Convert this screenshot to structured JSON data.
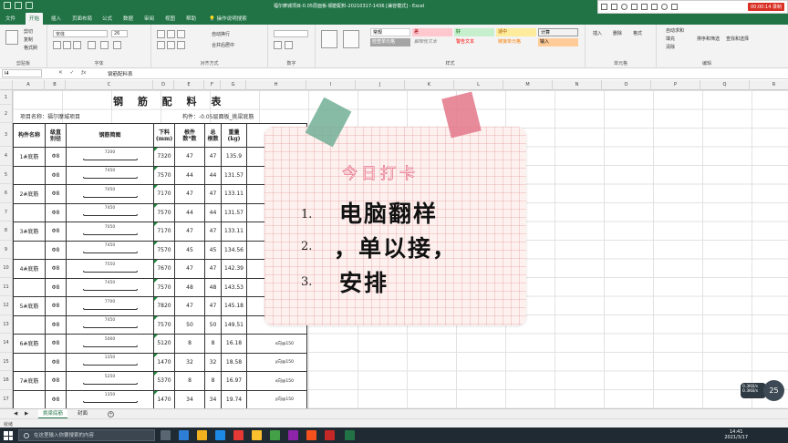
{
  "titlebar": {
    "title": "福尔摩城项目-0.05层面板-钢筋配料-20210317-1436 [兼容模式] - Excel"
  },
  "menu": {
    "tabs": [
      "文件",
      "开始",
      "插入",
      "页面布局",
      "公式",
      "数据",
      "审阅",
      "视图",
      "帮助"
    ],
    "active": "开始",
    "tell_me": "操作说明搜索"
  },
  "recorder": {
    "time": "00:00:14 录制"
  },
  "ribbon": {
    "clipboard": {
      "label": "剪贴板",
      "cut": "剪切",
      "copy": "复制",
      "painter": "格式刷"
    },
    "font": {
      "label": "字体",
      "name": "宋体",
      "size": "26"
    },
    "align": {
      "label": "对齐方式",
      "wrap": "自动换行",
      "merge": "合并后居中"
    },
    "number": {
      "label": "数字"
    },
    "styles": {
      "label": "样式",
      "items": [
        "常规",
        "差",
        "好",
        "适中",
        "检查单元格",
        "解释性文本",
        "警告文本",
        "链接单元格",
        "计算",
        "输入",
        "输出",
        "注释"
      ]
    },
    "cells": {
      "label": "单元格",
      "insert": "插入",
      "delete": "删除",
      "format": "格式"
    },
    "editing": {
      "label": "编辑",
      "autosum": "自动求和",
      "fill": "填充",
      "clear": "清除",
      "sort": "排序和筛选",
      "find": "查找和选择"
    }
  },
  "formula_bar": {
    "name_box": "I4",
    "formula": "钢筋配料表"
  },
  "columns": [
    "A",
    "B",
    "C",
    "D",
    "E",
    "F",
    "G",
    "H",
    "I",
    "J",
    "K",
    "L",
    "M",
    "N",
    "O",
    "P",
    "Q",
    "R",
    "S",
    "T"
  ],
  "rows": [
    "1",
    "2",
    "3",
    "4",
    "5",
    "6",
    "7",
    "8",
    "9",
    "10",
    "11",
    "12",
    "13",
    "14",
    "15",
    "16",
    "17"
  ],
  "sheet": {
    "title": "钢 筋 配 料 表",
    "project": "项目名称：福尔摩城项目",
    "member": "构件：-0.05层面板_挑梁底筋",
    "headers": [
      "构件名称",
      "级直\n别径",
      "钢筋简图",
      "下料\n(mm)",
      "根件\n数*数",
      "总\n根数",
      "重量\n(kg)",
      ""
    ],
    "data": [
      {
        "name": "1#底筋",
        "grade": "Φ8",
        "shape": "7200",
        "cut": "7320",
        "per": "47",
        "total": "47",
        "weight": "135.9",
        "note": ""
      },
      {
        "name": "",
        "grade": "Φ8",
        "shape": "7450",
        "cut": "7570",
        "per": "44",
        "total": "44",
        "weight": "131.57",
        "note": ""
      },
      {
        "name": "2#底筋",
        "grade": "Φ8",
        "shape": "7050",
        "cut": "7170",
        "per": "47",
        "total": "47",
        "weight": "133.11",
        "note": ""
      },
      {
        "name": "",
        "grade": "Φ8",
        "shape": "7450",
        "cut": "7570",
        "per": "44",
        "total": "44",
        "weight": "131.57",
        "note": ""
      },
      {
        "name": "3#底筋",
        "grade": "Φ8",
        "shape": "7050",
        "cut": "7170",
        "per": "47",
        "total": "47",
        "weight": "133.11",
        "note": ""
      },
      {
        "name": "",
        "grade": "Φ8",
        "shape": "7450",
        "cut": "7570",
        "per": "45",
        "total": "45",
        "weight": "134.56",
        "note": ""
      },
      {
        "name": "4#底筋",
        "grade": "Φ8",
        "shape": "7550",
        "cut": "7670",
        "per": "47",
        "total": "47",
        "weight": "142.39",
        "note": ""
      },
      {
        "name": "",
        "grade": "Φ8",
        "shape": "7450",
        "cut": "7570",
        "per": "48",
        "total": "48",
        "weight": "143.53",
        "note": ""
      },
      {
        "name": "5#底筋",
        "grade": "Φ8",
        "shape": "7700",
        "cut": "7820",
        "per": "47",
        "total": "47",
        "weight": "145.18",
        "note": ""
      },
      {
        "name": "",
        "grade": "Φ8",
        "shape": "7450",
        "cut": "7570",
        "per": "50",
        "total": "50",
        "weight": "149.51",
        "note": ""
      },
      {
        "name": "6#底筋",
        "grade": "Φ8",
        "shape": "5000",
        "cut": "5120",
        "per": "8",
        "total": "8",
        "weight": "16.18",
        "note": "x向@150"
      },
      {
        "name": "",
        "grade": "Φ8",
        "shape": "1350",
        "cut": "1470",
        "per": "32",
        "total": "32",
        "weight": "18.58",
        "note": "y向@150"
      },
      {
        "name": "7#底筋",
        "grade": "Φ8",
        "shape": "5250",
        "cut": "5370",
        "per": "8",
        "total": "8",
        "weight": "16.97",
        "note": "x向@150"
      },
      {
        "name": "",
        "grade": "Φ8",
        "shape": "1350",
        "cut": "1470",
        "per": "34",
        "total": "34",
        "weight": "19.74",
        "note": "y向@150"
      }
    ]
  },
  "card": {
    "title": "今日打卡",
    "items": [
      {
        "num": "1.",
        "text": "电脑翻样"
      },
      {
        "num": "2.",
        "text": "，单以接，"
      },
      {
        "num": "3.",
        "text": "安排"
      }
    ]
  },
  "sheet_tabs": [
    "挑梁底筋",
    "封面"
  ],
  "sheet_tabs_active": "挑梁底筋",
  "status": {
    "mode": "就绪"
  },
  "taskbar": {
    "search_placeholder": "在这里输入你要搜索的内容",
    "time": "14:41",
    "date": "2021/3/17"
  },
  "speed": {
    "up": "0.3KB/s",
    "down": "0.3KB/s",
    "badge": "25"
  },
  "colors": {
    "excel_green": "#217346",
    "tape_green": "#72af96",
    "tape_pink": "#e47a8c",
    "card_title": "#e25c78",
    "recorder": "#d93025"
  }
}
